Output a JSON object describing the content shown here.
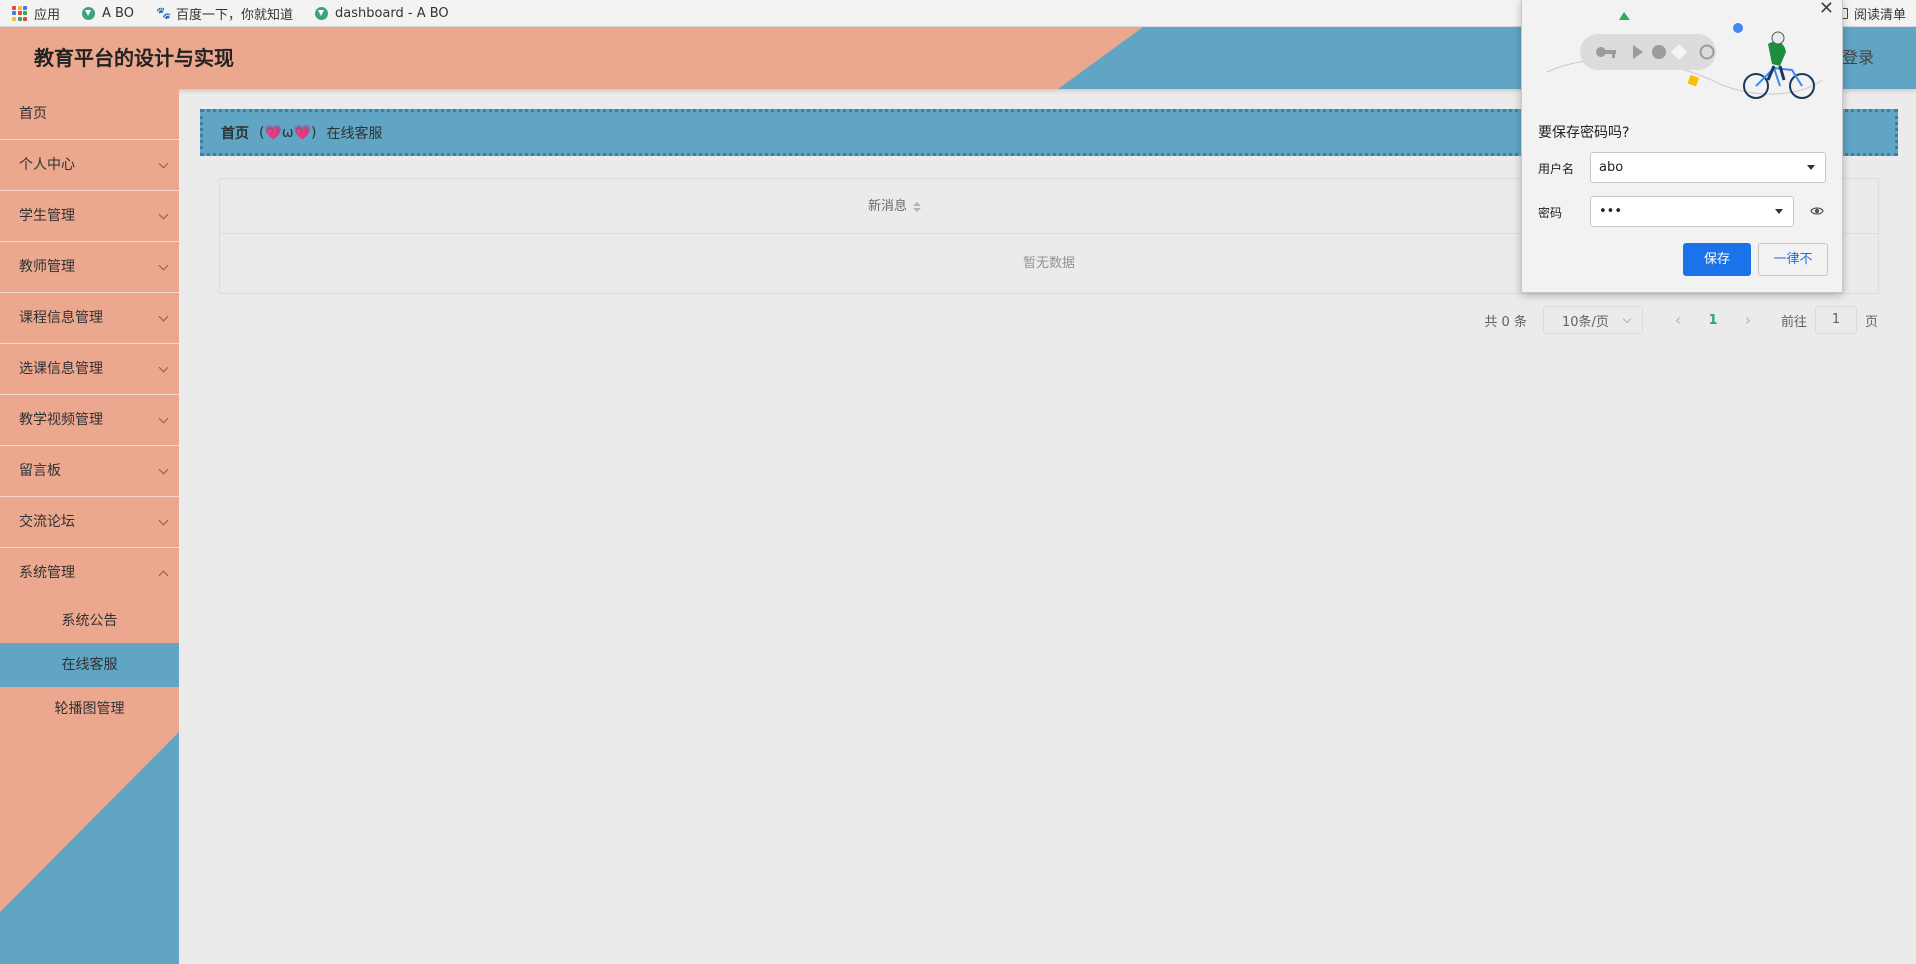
{
  "bookmarks": {
    "apps_label": "应用",
    "items": [
      {
        "label": "A BO",
        "icon": "vue-icon"
      },
      {
        "label": "百度一下，你就知道",
        "icon": "baidu-paw-icon"
      },
      {
        "label": "dashboard - A BO",
        "icon": "vue-icon"
      }
    ],
    "reading_list": "阅读清单"
  },
  "header": {
    "title": "教育平台的设计与实现",
    "login": "登录",
    "colors": {
      "salmon": "#eca88e",
      "blue": "#61a5c5"
    }
  },
  "sidebar": {
    "items": [
      {
        "label": "首页",
        "has_children": false
      },
      {
        "label": "个人中心",
        "has_children": true
      },
      {
        "label": "学生管理",
        "has_children": true
      },
      {
        "label": "教师管理",
        "has_children": true
      },
      {
        "label": "课程信息管理",
        "has_children": true
      },
      {
        "label": "选课信息管理",
        "has_children": true
      },
      {
        "label": "教学视频管理",
        "has_children": true
      },
      {
        "label": "留言板",
        "has_children": true
      },
      {
        "label": "交流论坛",
        "has_children": true
      },
      {
        "label": "系统管理",
        "has_children": true,
        "expanded": true
      }
    ],
    "sub_items": [
      {
        "label": "系统公告",
        "active": false
      },
      {
        "label": "在线客服",
        "active": true
      },
      {
        "label": "轮播图管理",
        "active": false
      }
    ]
  },
  "breadcrumb": {
    "home": "首页",
    "separator": "(💗ω💗)",
    "current": "在线客服"
  },
  "table": {
    "columns": [
      "新消息"
    ],
    "empty_text": "暂无数据"
  },
  "pagination": {
    "total": "共 0 条",
    "page_size": "10条/页",
    "prev": "‹",
    "current_page": "1",
    "next": "›",
    "goto_label": "前往",
    "goto_value": "1",
    "page_suffix": "页"
  },
  "save_password_popup": {
    "close": "✕",
    "title": "要保存密码吗?",
    "username_label": "用户名",
    "username_value": "abo",
    "password_label": "密码",
    "password_value": "•••",
    "save_button": "保存",
    "never_button": "一律不"
  }
}
